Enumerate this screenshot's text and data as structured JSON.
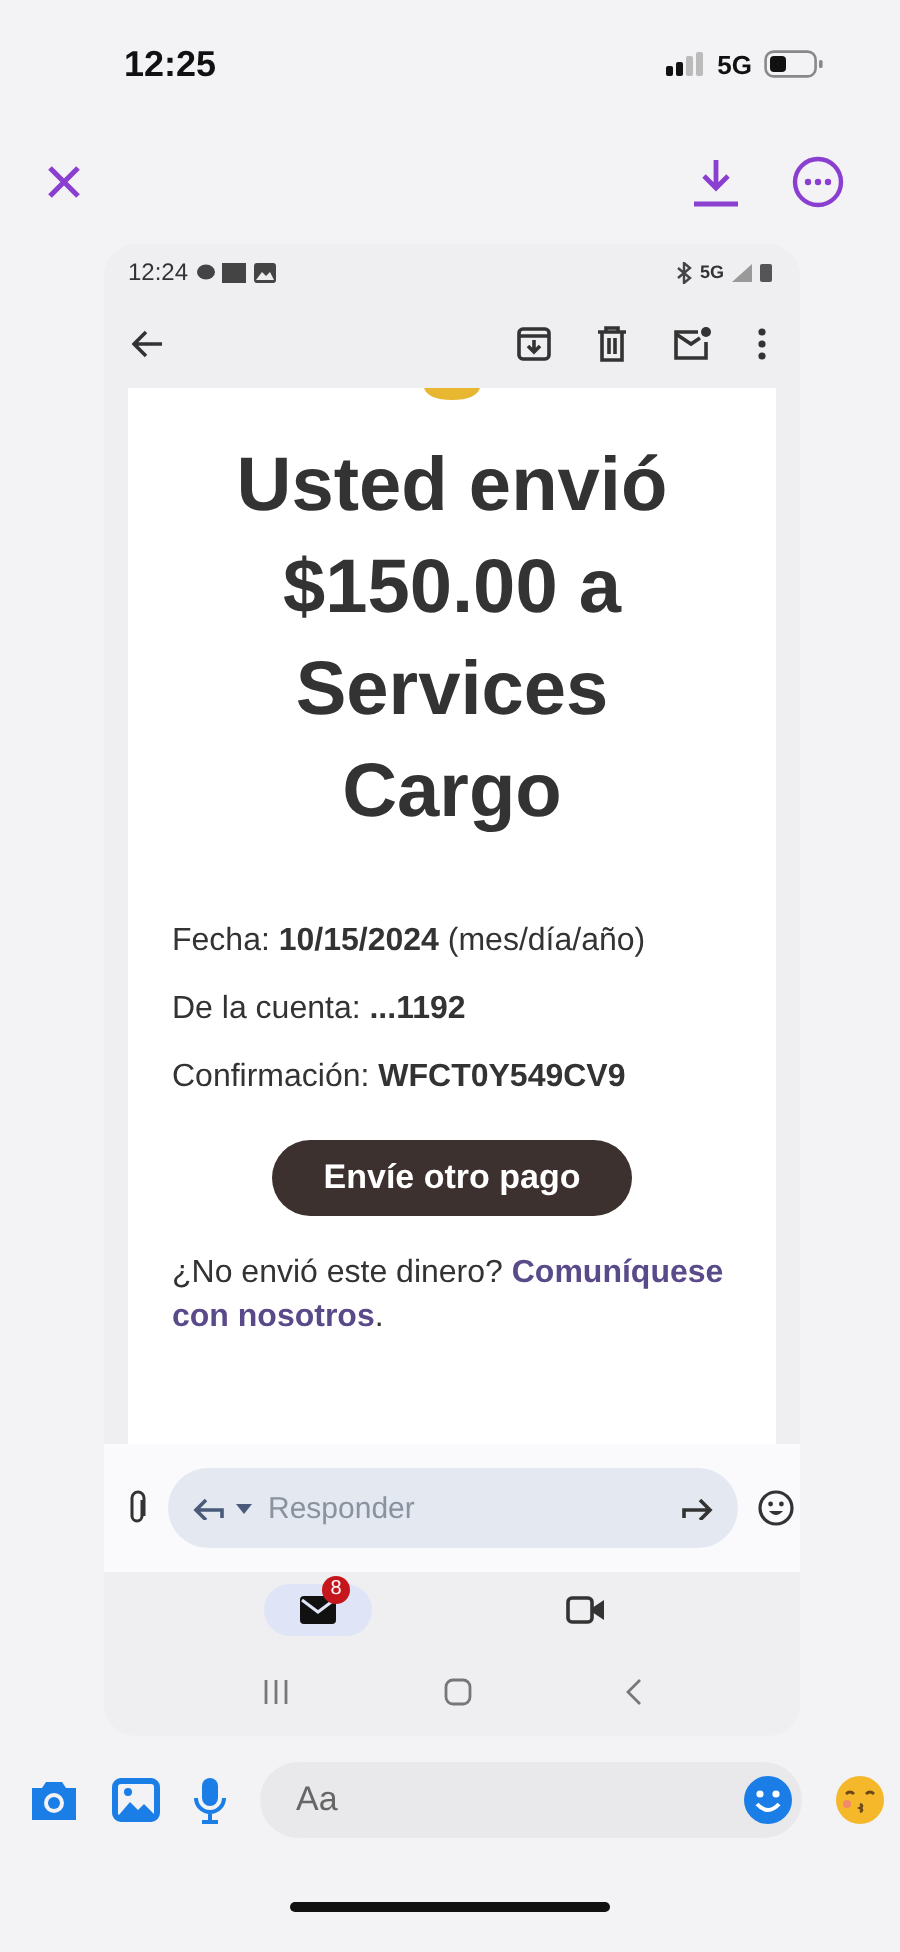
{
  "status_bar": {
    "time": "12:25",
    "network": "5G"
  },
  "viewer_bar": {
    "actions": [
      {
        "kind": "download"
      },
      {
        "kind": "more"
      }
    ]
  },
  "screenshot": {
    "status_bar": {
      "time": "12:24",
      "network": "5G"
    },
    "toolbar": {
      "actions": [
        {
          "kind": "archive"
        },
        {
          "kind": "delete"
        },
        {
          "kind": "mark-unread"
        },
        {
          "kind": "more"
        }
      ]
    },
    "email": {
      "title": "Usted envió $150.00 a Services Cargo",
      "details": [
        {
          "label": "Fecha: ",
          "value": "10/15/2024",
          "suffix": " (mes/día/año)"
        },
        {
          "label": "De la cuenta: ",
          "value": "...1192"
        },
        {
          "label": "Confirmación: ",
          "value": "WFCT0Y549CV9"
        }
      ],
      "button": "Envíe otro pago",
      "footer": {
        "text": "¿No envió este dinero? ",
        "link": "Comuníquese con nosotros",
        "end": "."
      }
    },
    "reply_bar": {
      "placeholder": "Responder"
    },
    "bottom_tabs": [
      {
        "kind": "mail",
        "selected": true,
        "badge": "8"
      },
      {
        "kind": "video",
        "selected": false
      }
    ]
  },
  "composer": {
    "placeholder": "Aa"
  }
}
